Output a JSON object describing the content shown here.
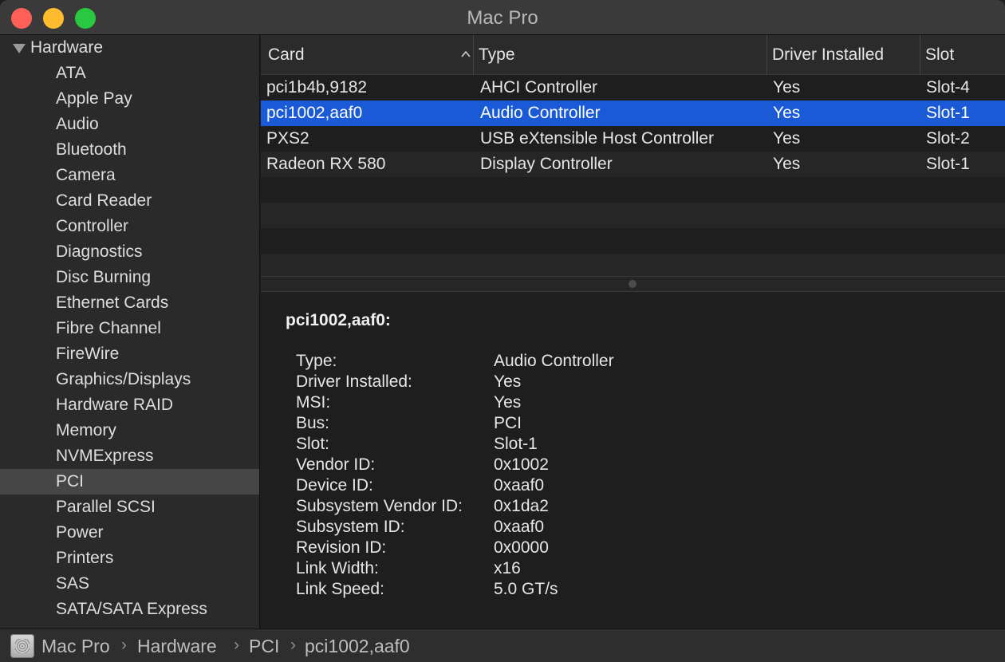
{
  "window": {
    "title": "Mac Pro"
  },
  "sidebar": {
    "group_label": "Hardware",
    "items": [
      {
        "label": "ATA"
      },
      {
        "label": "Apple Pay"
      },
      {
        "label": "Audio"
      },
      {
        "label": "Bluetooth"
      },
      {
        "label": "Camera"
      },
      {
        "label": "Card Reader"
      },
      {
        "label": "Controller"
      },
      {
        "label": "Diagnostics"
      },
      {
        "label": "Disc Burning"
      },
      {
        "label": "Ethernet Cards"
      },
      {
        "label": "Fibre Channel"
      },
      {
        "label": "FireWire"
      },
      {
        "label": "Graphics/Displays"
      },
      {
        "label": "Hardware RAID"
      },
      {
        "label": "Memory"
      },
      {
        "label": "NVMExpress"
      },
      {
        "label": "PCI",
        "selected": true
      },
      {
        "label": "Parallel SCSI"
      },
      {
        "label": "Power"
      },
      {
        "label": "Printers"
      },
      {
        "label": "SAS"
      },
      {
        "label": "SATA/SATA Express"
      }
    ]
  },
  "table": {
    "columns": [
      "Card",
      "Type",
      "Driver Installed",
      "Slot"
    ],
    "rows": [
      [
        "pci1b4b,9182",
        "AHCI Controller",
        "Yes",
        "Slot-4"
      ],
      [
        "pci1002,aaf0",
        "Audio Controller",
        "Yes",
        "Slot-1"
      ],
      [
        "PXS2",
        "USB eXtensible Host Controller",
        "Yes",
        "Slot-2"
      ],
      [
        "Radeon RX 580",
        "Display Controller",
        "Yes",
        "Slot-1"
      ]
    ],
    "selected_row": 1
  },
  "detail": {
    "title": "pci1002,aaf0:",
    "fields": [
      {
        "key": "Type:",
        "value": "Audio Controller"
      },
      {
        "key": "Driver Installed:",
        "value": "Yes"
      },
      {
        "key": "MSI:",
        "value": "Yes"
      },
      {
        "key": "Bus:",
        "value": "PCI"
      },
      {
        "key": "Slot:",
        "value": "Slot-1"
      },
      {
        "key": "Vendor ID:",
        "value": "0x1002"
      },
      {
        "key": "Device ID:",
        "value": "0xaaf0"
      },
      {
        "key": "Subsystem Vendor ID:",
        "value": "0x1da2"
      },
      {
        "key": "Subsystem ID:",
        "value": "0xaaf0"
      },
      {
        "key": "Revision ID:",
        "value": "0x0000"
      },
      {
        "key": "Link Width:",
        "value": "x16"
      },
      {
        "key": "Link Speed:",
        "value": "5.0 GT/s"
      }
    ]
  },
  "pathbar": {
    "crumbs": [
      "Mac Pro",
      "Hardware",
      "PCI",
      "pci1002,aaf0"
    ]
  },
  "icons": {
    "sort": "chevron-up-icon",
    "disclosure": "triangle-down-icon",
    "computer": "mac-pro-icon"
  },
  "colors": {
    "selection": "#1a5ad6",
    "close": "#fe5f57",
    "minimize": "#febc2e",
    "zoom": "#28c840"
  }
}
